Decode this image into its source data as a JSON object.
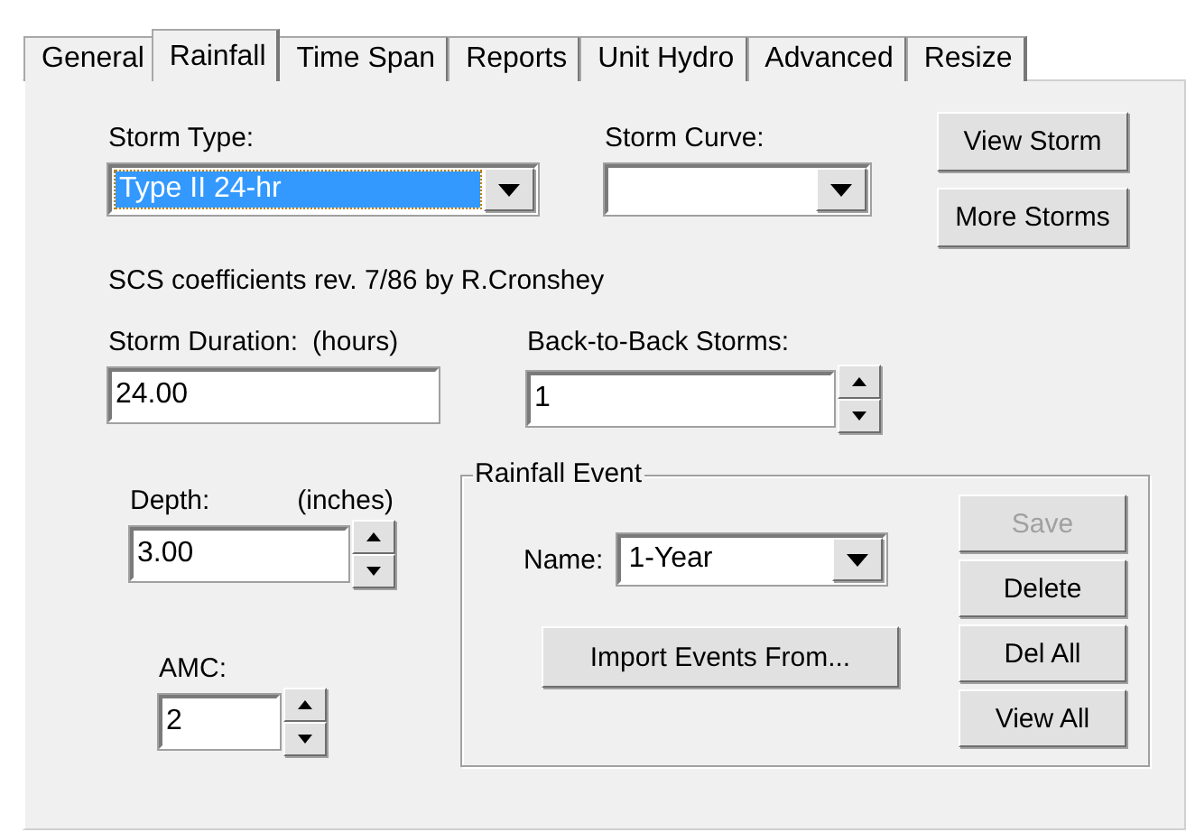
{
  "tabs": [
    {
      "label": "General",
      "selected": false
    },
    {
      "label": "Rainfall",
      "selected": true
    },
    {
      "label": "Time Span",
      "selected": false
    },
    {
      "label": "Reports",
      "selected": false
    },
    {
      "label": "Unit Hydro",
      "selected": false
    },
    {
      "label": "Advanced",
      "selected": false
    },
    {
      "label": "Resize",
      "selected": false
    }
  ],
  "storm_type": {
    "label": "Storm Type:",
    "value": "Type II 24-hr",
    "highlighted": true
  },
  "storm_curve": {
    "label": "Storm Curve:",
    "highlighted": false
  },
  "side_buttons": [
    {
      "label": "View Storm",
      "disabled": false
    },
    {
      "label": "More Storms",
      "disabled": false
    }
  ],
  "note": "SCS coefficients rev. 7/86 by R.Cronshey",
  "storm_duration": {
    "label": "Storm Duration:",
    "unit": "(hours)",
    "value": "24.00"
  },
  "back_to_back": {
    "label": "Back-to-Back Storms:",
    "value": "1"
  },
  "depth": {
    "label": "Depth:",
    "unit": "(inches)",
    "value": "3.00"
  },
  "amc": {
    "label": "AMC:",
    "value": "2"
  },
  "rainfall_event": {
    "title": "Rainfall Event",
    "name_label": "Name:",
    "name_value": "1-Year",
    "highlighted": false,
    "import_button": "Import Events From...",
    "buttons": [
      {
        "label": "Save",
        "disabled": true
      },
      {
        "label": "Delete",
        "disabled": false
      },
      {
        "label": "Del All",
        "disabled": false
      },
      {
        "label": "View All",
        "disabled": false
      }
    ]
  }
}
